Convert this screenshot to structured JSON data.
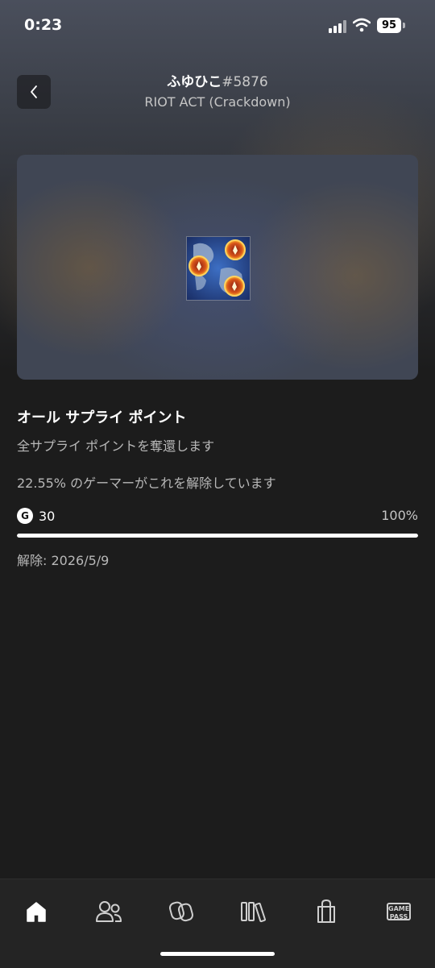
{
  "status_bar": {
    "time": "0:23",
    "battery": "95"
  },
  "header": {
    "gamertag": "ふゆひこ",
    "gamertag_suffix": "#5876",
    "game_title": "RIOT ACT (Crackdown)"
  },
  "achievement": {
    "title": "オール サプライ ポイント",
    "description": "全サプライ ポイントを奪還します",
    "rarity": "22.55% のゲーマーがこれを解除しています",
    "gamerscore_badge": "G",
    "gamerscore": "30",
    "progress_text": "100%",
    "progress_fraction": 1.0,
    "unlocked": "解除: 2026/5/9"
  },
  "nav": {
    "items": [
      {
        "icon": "home-icon",
        "active": true
      },
      {
        "icon": "friends-icon",
        "active": false
      },
      {
        "icon": "copilot-icon",
        "active": false
      },
      {
        "icon": "library-icon",
        "active": false
      },
      {
        "icon": "store-icon",
        "active": false
      },
      {
        "icon": "game-pass-icon",
        "active": false
      }
    ],
    "gamepass_line1": "GAME",
    "gamepass_line2": "PASS"
  },
  "colors": {
    "background": "#1c1c1c",
    "accent": "#ffffff",
    "muted_text": "#b8b8b8"
  }
}
